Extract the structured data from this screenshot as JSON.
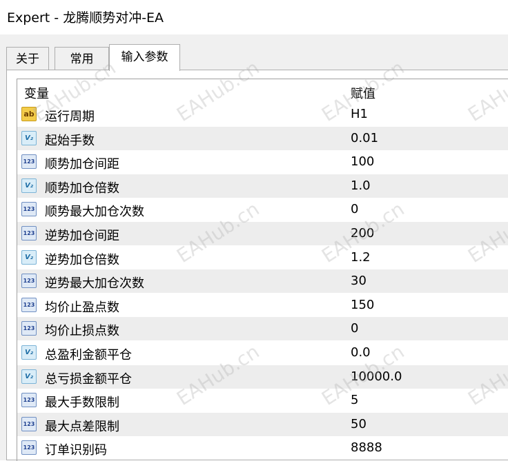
{
  "window": {
    "title": "Expert - 龙腾顺势对冲-EA"
  },
  "tabs": [
    {
      "label": "关于",
      "active": false
    },
    {
      "label": "常用",
      "active": false
    },
    {
      "label": "输入参数",
      "active": true
    }
  ],
  "table": {
    "columns": {
      "name": "变量",
      "value": "赋值"
    },
    "rows": [
      {
        "type": "string-icon",
        "icon_text": "ab",
        "name": "运行周期",
        "value": "H1"
      },
      {
        "type": "double-icon",
        "icon_text": "V₂",
        "name": "起始手数",
        "value": "0.01"
      },
      {
        "type": "integer-icon",
        "icon_text": "123",
        "name": "顺势加仓间距",
        "value": "100"
      },
      {
        "type": "double-icon",
        "icon_text": "V₂",
        "name": "顺势加仓倍数",
        "value": "1.0"
      },
      {
        "type": "integer-icon",
        "icon_text": "123",
        "name": "顺势最大加仓次数",
        "value": "0"
      },
      {
        "type": "integer-icon",
        "icon_text": "123",
        "name": "逆势加仓间距",
        "value": "200"
      },
      {
        "type": "double-icon",
        "icon_text": "V₂",
        "name": "逆势加仓倍数",
        "value": "1.2"
      },
      {
        "type": "integer-icon",
        "icon_text": "123",
        "name": "逆势最大加仓次数",
        "value": "30"
      },
      {
        "type": "integer-icon",
        "icon_text": "123",
        "name": "均价止盈点数",
        "value": "150"
      },
      {
        "type": "integer-icon",
        "icon_text": "123",
        "name": "均价止损点数",
        "value": "0"
      },
      {
        "type": "double-icon",
        "icon_text": "V₂",
        "name": "总盈利金额平仓",
        "value": "0.0"
      },
      {
        "type": "double-icon",
        "icon_text": "V₂",
        "name": "总亏损金额平仓",
        "value": "10000.0"
      },
      {
        "type": "integer-icon",
        "icon_text": "123",
        "name": "最大手数限制",
        "value": "5"
      },
      {
        "type": "integer-icon",
        "icon_text": "123",
        "name": "最大点差限制",
        "value": "50"
      },
      {
        "type": "integer-icon",
        "icon_text": "123",
        "name": "订单识别码",
        "value": "8888"
      }
    ]
  },
  "watermark": {
    "text": "EAHub.cn"
  }
}
